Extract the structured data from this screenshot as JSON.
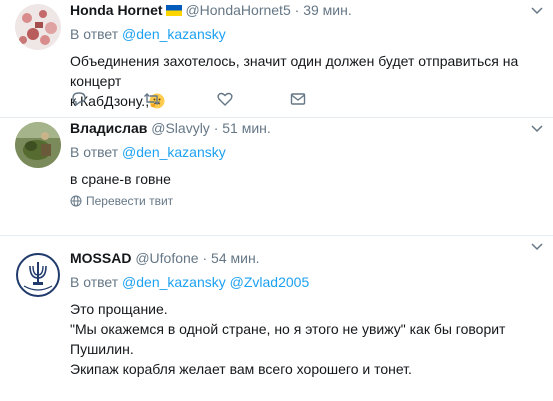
{
  "tweets": [
    {
      "name": "Honda Hornet",
      "handle": "@HondaHornet5",
      "time": "39 мин.",
      "reply_prefix": "В ответ",
      "mentions": [
        "@den_kazansky"
      ],
      "lines": [
        "Объединения захотелось, значит один должен будет отправиться на концерт",
        "к КабДзону.,"
      ],
      "flag_colors": [
        "#005bbb",
        "#ffd500"
      ]
    },
    {
      "name": "Владислав",
      "handle": "@Slavyly",
      "time": "51 мин.",
      "reply_prefix": "В ответ",
      "mentions": [
        "@den_kazansky"
      ],
      "lines": [
        "в сране-в говне"
      ],
      "translate": "Перевести твит"
    },
    {
      "name": "MOSSAD",
      "handle": "@Ufofone",
      "time": "54 мин.",
      "reply_prefix": "В ответ",
      "mentions": [
        "@den_kazansky",
        "@Zvlad2005"
      ],
      "lines": [
        "Это прощание.",
        "\"Мы окажемся в одной стране, но я этого не увижу\" как бы говорит",
        "Пушилин.",
        "Экипаж корабля желает вам всего хорошего и тонет."
      ]
    }
  ],
  "separator": "·",
  "icons": {
    "reply": "reply-icon",
    "retweet": "retweet-icon",
    "like": "heart-icon",
    "dm": "envelope-icon",
    "caret": "chevron-down-icon",
    "globe": "globe-icon",
    "emoji": "thinking-face-emoji"
  },
  "colors": {
    "link": "#1da1f2",
    "secondary": "#657786",
    "divider": "#e6ecf0"
  }
}
